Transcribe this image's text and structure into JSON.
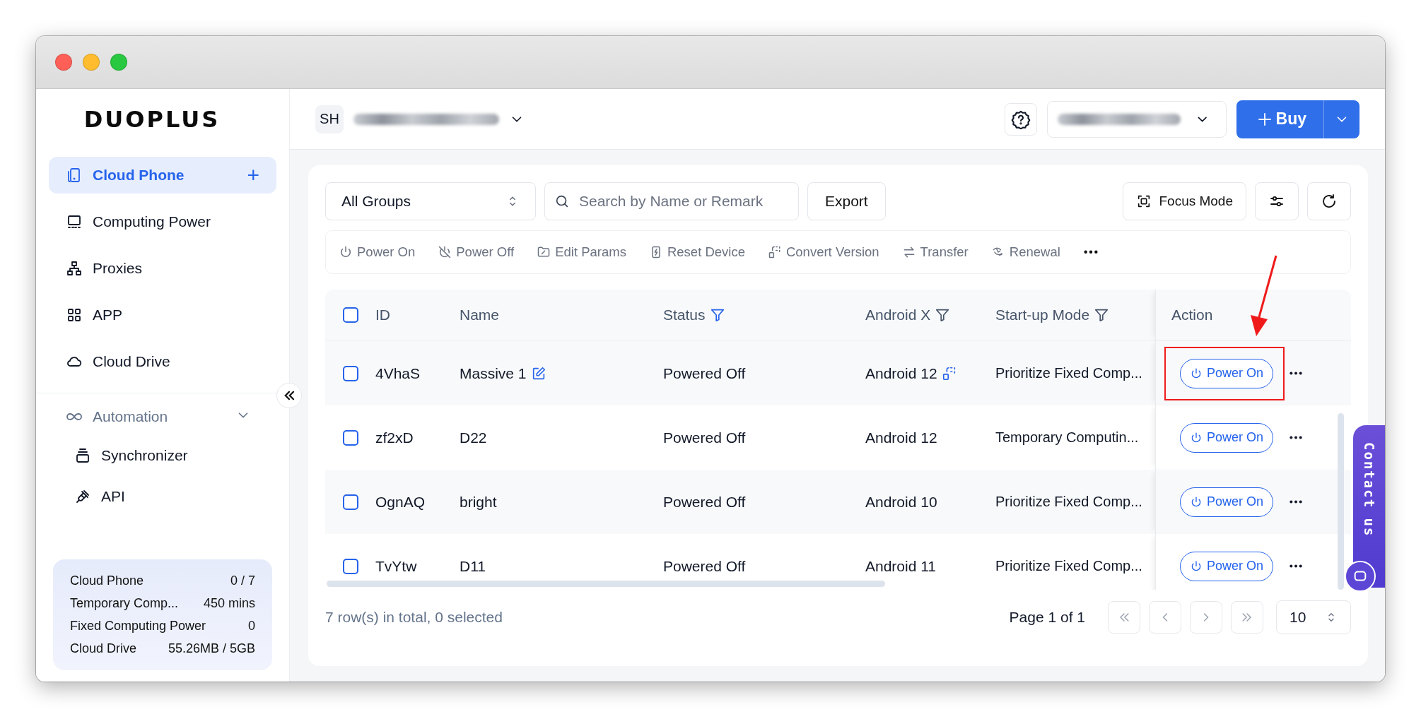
{
  "brand": {
    "logo": "DUOPLUS"
  },
  "sidebar": {
    "items": [
      {
        "label": "Cloud Phone",
        "selected": true,
        "add": "+"
      },
      {
        "label": "Computing Power",
        "selected": false
      },
      {
        "label": "Proxies",
        "selected": false
      },
      {
        "label": "APP",
        "selected": false
      },
      {
        "label": "Cloud Drive",
        "selected": false
      }
    ],
    "automation": {
      "label": "Automation",
      "expanded": true,
      "children": [
        {
          "label": "Synchronizer"
        },
        {
          "label": "API"
        }
      ]
    },
    "usage": [
      {
        "label": "Cloud Phone",
        "value": "0 / 7"
      },
      {
        "label": "Temporary Comp...",
        "value": "450 mins"
      },
      {
        "label": "Fixed Computing Power",
        "value": "0"
      },
      {
        "label": "Cloud Drive",
        "value": "55.26MB / 5GB"
      }
    ]
  },
  "header": {
    "avatar": "SH",
    "buy": "Buy"
  },
  "toolbar": {
    "group": "All Groups",
    "search_placeholder": "Search by Name or Remark",
    "export": "Export",
    "focus_mode": "Focus Mode"
  },
  "actions": [
    {
      "label": "Power On"
    },
    {
      "label": "Power Off"
    },
    {
      "label": "Edit Params"
    },
    {
      "label": "Reset Device"
    },
    {
      "label": "Convert Version"
    },
    {
      "label": "Transfer"
    },
    {
      "label": "Renewal"
    }
  ],
  "table": {
    "all_checked": false,
    "columns": [
      {
        "label": "ID",
        "filter": false
      },
      {
        "label": "Name",
        "filter": false
      },
      {
        "label": "Status",
        "filter": true,
        "active": true
      },
      {
        "label": "Android X",
        "filter": true,
        "active": false
      },
      {
        "label": "Start-up Mode",
        "filter": true,
        "active": false
      },
      {
        "label": "Action",
        "filter": false
      }
    ],
    "rows": [
      {
        "checked": false,
        "id": "4VhaS",
        "name": "Massive 1",
        "editable": true,
        "status": "Powered Off",
        "android": "Android 12",
        "converted": true,
        "startup": "Prioritize Fixed Comp...",
        "action": "Power On",
        "highlighted": true
      },
      {
        "checked": false,
        "id": "zf2xD",
        "name": "D22",
        "editable": false,
        "status": "Powered Off",
        "android": "Android 12",
        "converted": false,
        "startup": "Temporary Computin...",
        "action": "Power On",
        "highlighted": false
      },
      {
        "checked": false,
        "id": "OgnAQ",
        "name": "bright",
        "editable": false,
        "status": "Powered Off",
        "android": "Android 10",
        "converted": false,
        "startup": "Prioritize Fixed Comp...",
        "action": "Power On",
        "highlighted": false
      },
      {
        "checked": false,
        "id": "TvYtw",
        "name": "D11",
        "editable": false,
        "status": "Powered Off",
        "android": "Android 11",
        "converted": false,
        "startup": "Prioritize Fixed Comp...",
        "action": "Power On",
        "highlighted": false
      }
    ],
    "summary": "7 row(s) in total, 0 selected"
  },
  "pagination": {
    "page": "Page 1 of 1",
    "page_size": "10"
  },
  "contact": {
    "label": "Contact us"
  }
}
